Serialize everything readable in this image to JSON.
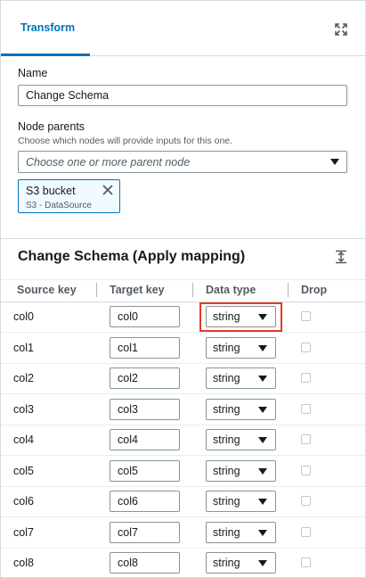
{
  "panel": {
    "active_tab": "Transform"
  },
  "name_field": {
    "label": "Name",
    "value": "Change Schema"
  },
  "node_parents": {
    "label": "Node parents",
    "description": "Choose which nodes will provide inputs for this one.",
    "placeholder": "Choose one or more parent node",
    "selected": [
      {
        "name": "S3 bucket",
        "description": "S3 - DataSource"
      }
    ]
  },
  "mapping": {
    "title": "Change Schema (Apply mapping)",
    "columns": [
      "Source key",
      "Target key",
      "Data type",
      "Drop"
    ],
    "rows": [
      {
        "source": "col0",
        "target": "col0",
        "type": "string",
        "drop": false
      },
      {
        "source": "col1",
        "target": "col1",
        "type": "string",
        "drop": false
      },
      {
        "source": "col2",
        "target": "col2",
        "type": "string",
        "drop": false
      },
      {
        "source": "col3",
        "target": "col3",
        "type": "string",
        "drop": false
      },
      {
        "source": "col4",
        "target": "col4",
        "type": "string",
        "drop": false
      },
      {
        "source": "col5",
        "target": "col5",
        "type": "string",
        "drop": false
      },
      {
        "source": "col6",
        "target": "col6",
        "type": "string",
        "drop": false
      },
      {
        "source": "col7",
        "target": "col7",
        "type": "string",
        "drop": false
      },
      {
        "source": "col8",
        "target": "col8",
        "type": "string",
        "drop": false
      }
    ]
  },
  "colors": {
    "accent": "#0073bb",
    "highlight": "#e53a25"
  },
  "icons": {
    "expand": "expand-icon",
    "remove_token": "close-icon",
    "collapse": "collapse-icon",
    "dropdown": "caret-down-icon"
  }
}
